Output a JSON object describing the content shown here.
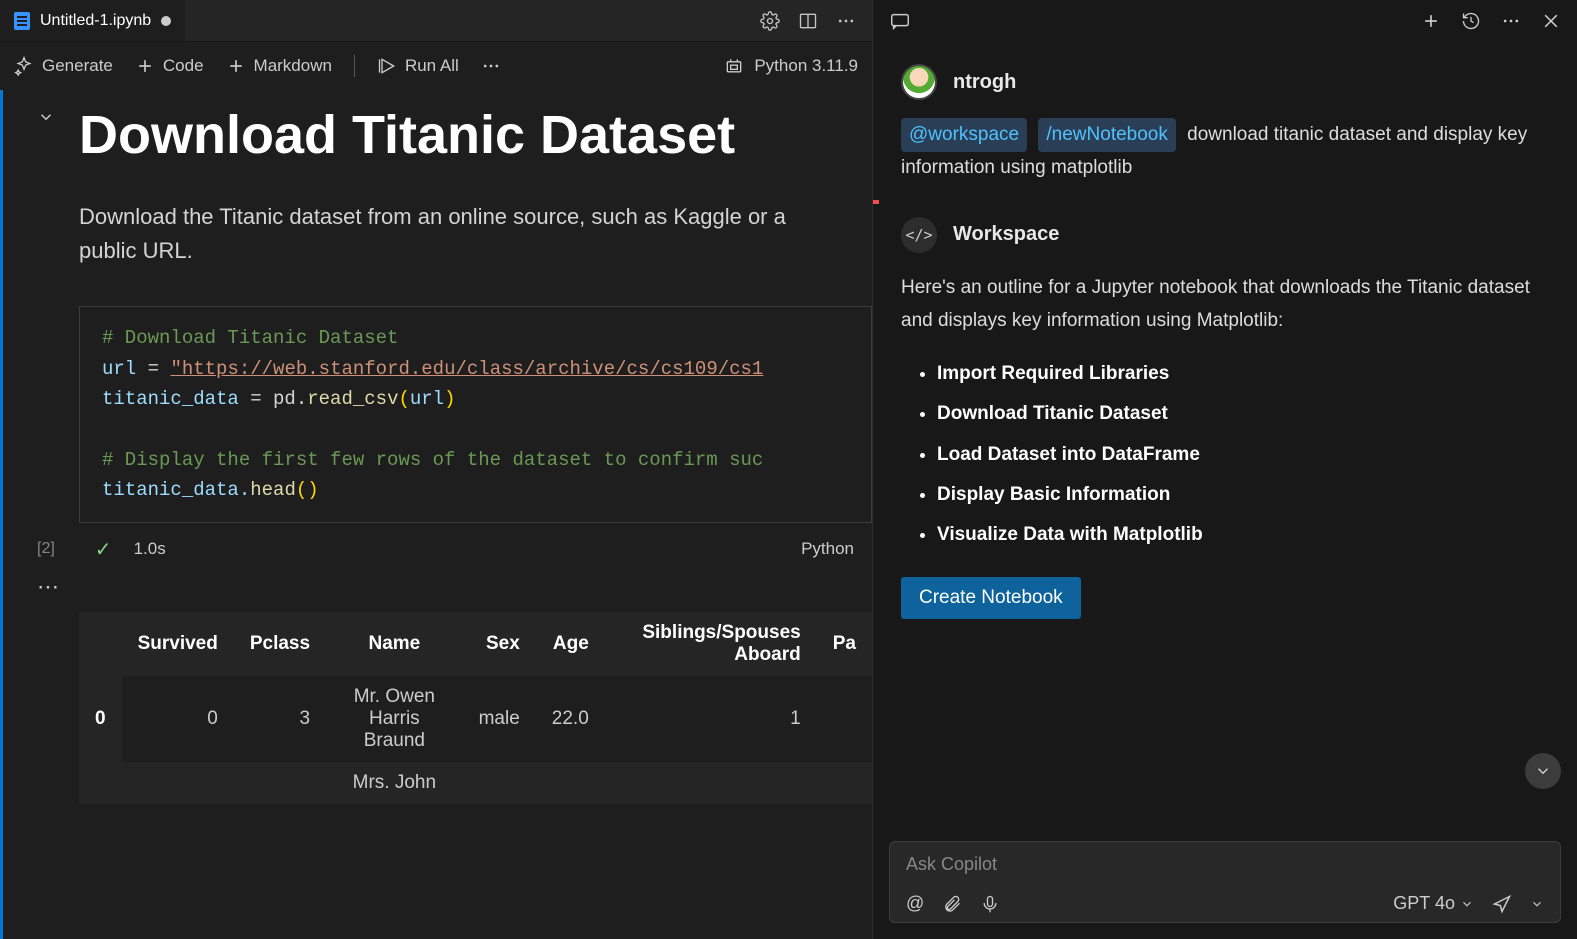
{
  "tab": {
    "filename": "Untitled-1.ipynb"
  },
  "toolbar": {
    "generate": "Generate",
    "code": "Code",
    "markdown": "Markdown",
    "runall": "Run All",
    "kernel": "Python 3.11.9"
  },
  "markdown": {
    "title": "Download Titanic Dataset",
    "body": "Download the Titanic dataset from an online source, such as Kaggle or a public URL."
  },
  "code": {
    "comment1": "# Download Titanic Dataset",
    "line2a": "url",
    "line2b": " = ",
    "line2c": "\"https://web.stanford.edu/class/archive/cs/cs109/cs1",
    "line3a": "titanic_data",
    "line3b": " = pd.",
    "line3c": "read_csv",
    "line3d": "(",
    "line3e": "url",
    "line3f": ")",
    "comment2": "# Display the first few rows of the dataset to confirm suc",
    "line5a": "titanic_data.",
    "line5b": "head",
    "line5c": "(",
    "line5d": ")"
  },
  "exec": {
    "label": "[2]",
    "duration": "1.0s",
    "lang": "Python"
  },
  "table": {
    "headers": [
      "Survived",
      "Pclass",
      "Name",
      "Sex",
      "Age",
      "Siblings/Spouses Aboard",
      "Pa"
    ],
    "rows": [
      {
        "idx": "0",
        "v": [
          "0",
          "3",
          "Mr. Owen Harris Braund",
          "male",
          "22.0",
          "1",
          ""
        ]
      },
      {
        "idx": "",
        "v": [
          "",
          "",
          "Mrs. John",
          "",
          "",
          "",
          ""
        ]
      }
    ]
  },
  "chat": {
    "username": "ntrogh",
    "pill1": "@workspace",
    "pill2": "/newNotebook",
    "userPrompt": "download titanic dataset and display key information using matplotlib",
    "astName": "Workspace",
    "astIntro": "Here's an outline for a Jupyter notebook that downloads the Titanic dataset and displays key information using Matplotlib:",
    "bullets": [
      "Import Required Libraries",
      "Download Titanic Dataset",
      "Load Dataset into DataFrame",
      "Display Basic Information",
      "Visualize Data with Matplotlib"
    ],
    "createBtn": "Create Notebook",
    "placeholder": "Ask Copilot",
    "model": "GPT 4o"
  }
}
